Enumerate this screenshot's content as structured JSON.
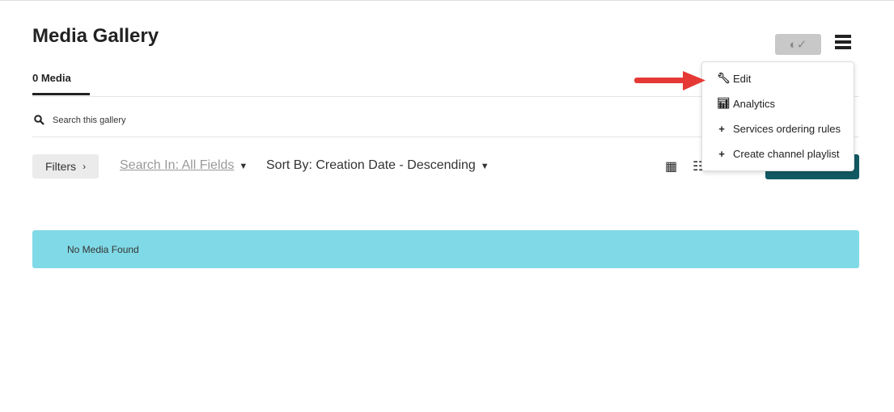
{
  "page": {
    "title": "Media Gallery"
  },
  "tabs": [
    {
      "label": "0 Media"
    }
  ],
  "search": {
    "placeholder": "Search this gallery"
  },
  "toolbar": {
    "filters_label": "Filters",
    "search_in_label": "Search In: All Fields",
    "sort_label": "Sort By: Creation Date - Descending"
  },
  "empty_state": {
    "message": "No Media Found"
  },
  "menu": {
    "items": [
      {
        "label": "Edit",
        "icon": "wrench-icon"
      },
      {
        "label": "Analytics",
        "icon": "bar-chart-icon"
      },
      {
        "label": "Services ordering rules",
        "icon": "plus-icon"
      },
      {
        "label": "Create channel playlist",
        "icon": "plus-icon"
      }
    ]
  },
  "colors": {
    "accent": "#125a63",
    "alert": "#80d9e6",
    "arrow": "#e53935"
  }
}
